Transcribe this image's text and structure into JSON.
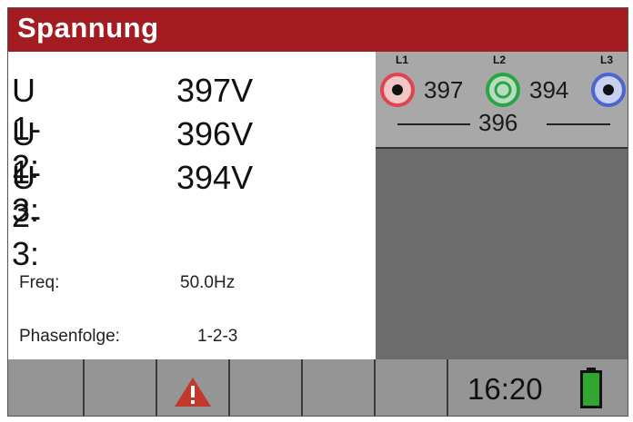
{
  "header": {
    "title": "Spannung"
  },
  "voltages": [
    {
      "label": "U 1-2:",
      "value": "397V"
    },
    {
      "label": "U 1-3:",
      "value": "396V"
    },
    {
      "label": "U 2-3:",
      "value": "394V"
    }
  ],
  "info": {
    "freq_label": "Freq:",
    "freq_value": "50.0Hz",
    "phase_label": "Phasenfolge:",
    "phase_value": "1-2-3"
  },
  "diagram": {
    "phases": [
      {
        "label": "L1",
        "color": "#e0454e"
      },
      {
        "label": "L2",
        "color": "#2aa545"
      },
      {
        "label": "L3",
        "color": "#4a64d0"
      }
    ],
    "v12": "397",
    "v23": "394",
    "v13": "396"
  },
  "footer": {
    "time": "16:20",
    "warning_icon": "warning-icon",
    "battery_icon": "battery-full-icon",
    "battery_color": "#2fa62f",
    "alert_color": "#c0392b"
  }
}
